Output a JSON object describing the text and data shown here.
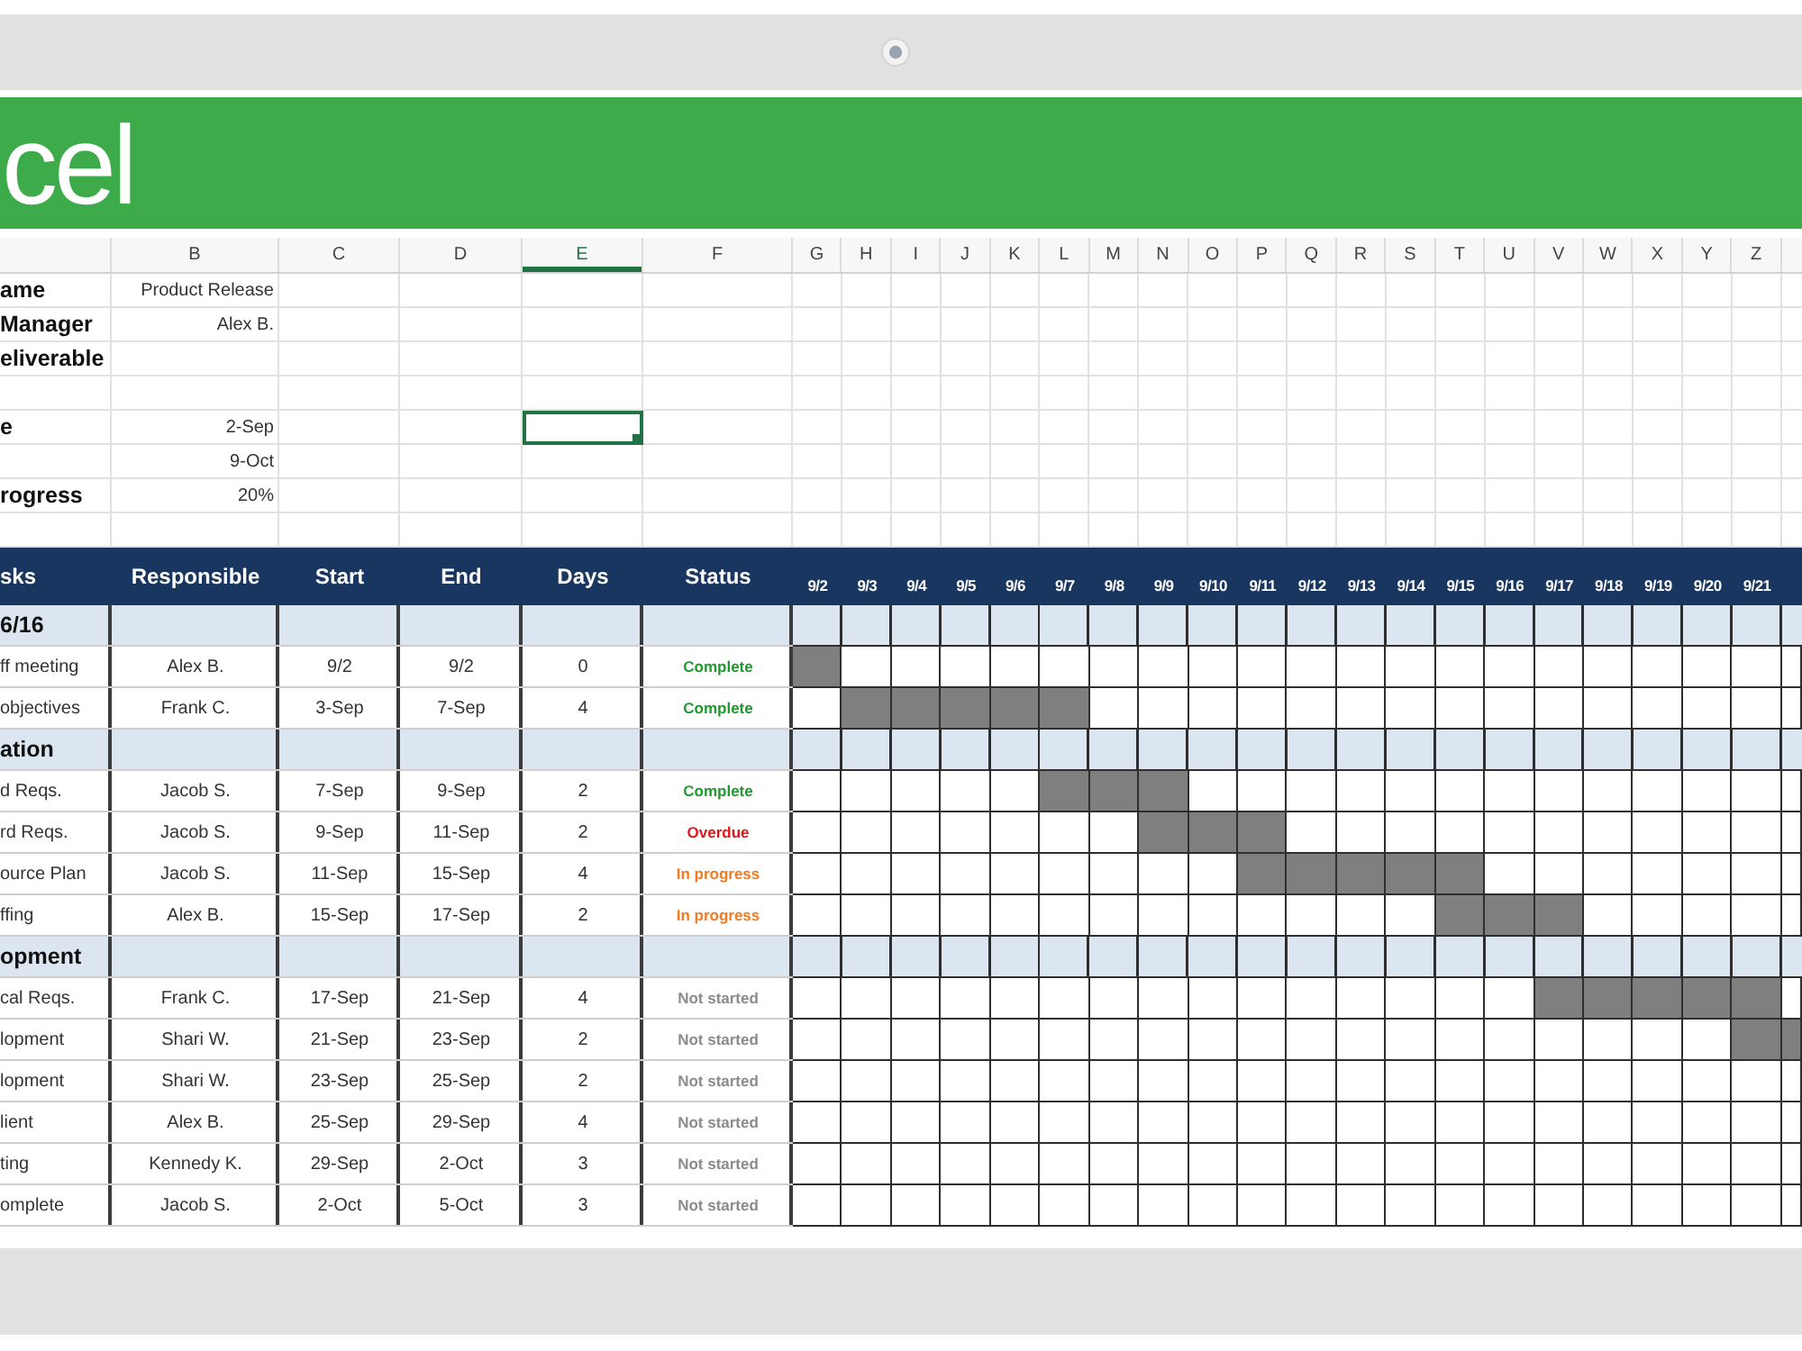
{
  "banner": {
    "title": "cel"
  },
  "sheet": {
    "column_headers": [
      {
        "label": "B",
        "selected": false
      },
      {
        "label": "C",
        "selected": false
      },
      {
        "label": "D",
        "selected": false
      },
      {
        "label": "E",
        "selected": true
      },
      {
        "label": "F",
        "selected": false
      },
      {
        "label": "G",
        "selected": false
      },
      {
        "label": "H",
        "selected": false
      },
      {
        "label": "I",
        "selected": false
      },
      {
        "label": "J",
        "selected": false
      },
      {
        "label": "K",
        "selected": false
      },
      {
        "label": "L",
        "selected": false
      },
      {
        "label": "M",
        "selected": false
      },
      {
        "label": "N",
        "selected": false
      },
      {
        "label": "O",
        "selected": false
      },
      {
        "label": "P",
        "selected": false
      },
      {
        "label": "Q",
        "selected": false
      },
      {
        "label": "R",
        "selected": false
      },
      {
        "label": "S",
        "selected": false
      },
      {
        "label": "T",
        "selected": false
      },
      {
        "label": "U",
        "selected": false
      },
      {
        "label": "V",
        "selected": false
      },
      {
        "label": "W",
        "selected": false
      },
      {
        "label": "X",
        "selected": false
      },
      {
        "label": "Y",
        "selected": false
      },
      {
        "label": "Z",
        "selected": false
      }
    ],
    "info_rows": [
      {
        "label": "ame",
        "value": "Product Release",
        "selected": false
      },
      {
        "label": "Manager",
        "value": "Alex B.",
        "selected": false
      },
      {
        "label": "eliverable",
        "selected": false
      },
      {
        "selected": false
      },
      {
        "label": "e",
        "value": "2-Sep",
        "selected": true
      },
      {
        "value": "9-Oct",
        "selected": false
      },
      {
        "label": "rogress",
        "value": "20%",
        "selected": false
      },
      {
        "selected": false
      }
    ]
  },
  "task_table": {
    "columns": [
      "sks",
      "Responsible",
      "Start",
      "End",
      "Days",
      "Status"
    ],
    "timeline_dates": [
      "9/2",
      "9/3",
      "9/4",
      "9/5",
      "9/6",
      "9/7",
      "9/8",
      "9/9",
      "9/10",
      "9/11",
      "9/12",
      "9/13",
      "9/14",
      "9/15",
      "9/16",
      "9/17",
      "9/18",
      "9/19",
      "9/20",
      "9/21"
    ],
    "sections": [
      {
        "title": "6/16",
        "tasks": [
          {
            "name": "ff meeting",
            "responsible": "Alex B.",
            "start": "9/2",
            "end": "9/2",
            "days": "0",
            "status": "Complete",
            "color": "#1e9b2d",
            "timeline": [
              true,
              false,
              false,
              false,
              false,
              false,
              false,
              false,
              false,
              false,
              false,
              false,
              false,
              false,
              false,
              false,
              false,
              false,
              false,
              false,
              false
            ]
          },
          {
            "name": "objectives",
            "responsible": "Frank C.",
            "start": "3-Sep",
            "end": "7-Sep",
            "days": "4",
            "status": "Complete",
            "color": "#1e9b2d",
            "timeline": [
              false,
              true,
              true,
              true,
              true,
              true,
              false,
              false,
              false,
              false,
              false,
              false,
              false,
              false,
              false,
              false,
              false,
              false,
              false,
              false,
              false
            ]
          }
        ]
      },
      {
        "title": "ation",
        "tasks": [
          {
            "name": "d Reqs.",
            "responsible": "Jacob S.",
            "start": "7-Sep",
            "end": "9-Sep",
            "days": "2",
            "status": "Complete",
            "color": "#1e9b2d",
            "timeline": [
              false,
              false,
              false,
              false,
              false,
              true,
              true,
              true,
              false,
              false,
              false,
              false,
              false,
              false,
              false,
              false,
              false,
              false,
              false,
              false,
              false
            ]
          },
          {
            "name": "rd Reqs.",
            "responsible": "Jacob S.",
            "start": "9-Sep",
            "end": "11-Sep",
            "days": "2",
            "status": "Overdue",
            "color": "#e3161b",
            "timeline": [
              false,
              false,
              false,
              false,
              false,
              false,
              false,
              true,
              true,
              true,
              false,
              false,
              false,
              false,
              false,
              false,
              false,
              false,
              false,
              false,
              false
            ]
          },
          {
            "name": "ource Plan",
            "responsible": "Jacob S.",
            "start": "11-Sep",
            "end": "15-Sep",
            "days": "4",
            "status": "In progress",
            "color": "#f47b20",
            "timeline": [
              false,
              false,
              false,
              false,
              false,
              false,
              false,
              false,
              false,
              true,
              true,
              true,
              true,
              true,
              false,
              false,
              false,
              false,
              false,
              false,
              false
            ]
          },
          {
            "name": "ffing",
            "responsible": "Alex B.",
            "start": "15-Sep",
            "end": "17-Sep",
            "days": "2",
            "status": "In progress",
            "color": "#f47b20",
            "timeline": [
              false,
              false,
              false,
              false,
              false,
              false,
              false,
              false,
              false,
              false,
              false,
              false,
              false,
              true,
              true,
              true,
              false,
              false,
              false,
              false,
              false
            ]
          }
        ]
      },
      {
        "title": "opment",
        "tasks": [
          {
            "name": "cal Reqs.",
            "responsible": "Frank C.",
            "start": "17-Sep",
            "end": "21-Sep",
            "days": "4",
            "status": "Not started",
            "color": "#8c8c8c",
            "timeline": [
              false,
              false,
              false,
              false,
              false,
              false,
              false,
              false,
              false,
              false,
              false,
              false,
              false,
              false,
              false,
              true,
              true,
              true,
              true,
              true,
              false
            ]
          },
          {
            "name": "lopment",
            "responsible": "Shari W.",
            "start": "21-Sep",
            "end": "23-Sep",
            "days": "2",
            "status": "Not started",
            "color": "#8c8c8c",
            "timeline": [
              false,
              false,
              false,
              false,
              false,
              false,
              false,
              false,
              false,
              false,
              false,
              false,
              false,
              false,
              false,
              false,
              false,
              false,
              false,
              true,
              true
            ]
          },
          {
            "name": "lopment",
            "responsible": "Shari W.",
            "start": "23-Sep",
            "end": "25-Sep",
            "days": "2",
            "status": "Not started",
            "color": "#8c8c8c",
            "timeline": [
              false,
              false,
              false,
              false,
              false,
              false,
              false,
              false,
              false,
              false,
              false,
              false,
              false,
              false,
              false,
              false,
              false,
              false,
              false,
              false,
              false
            ]
          },
          {
            "name": "lient",
            "responsible": "Alex B.",
            "start": "25-Sep",
            "end": "29-Sep",
            "days": "4",
            "status": "Not started",
            "color": "#8c8c8c",
            "timeline": [
              false,
              false,
              false,
              false,
              false,
              false,
              false,
              false,
              false,
              false,
              false,
              false,
              false,
              false,
              false,
              false,
              false,
              false,
              false,
              false,
              false
            ]
          },
          {
            "name": "ting",
            "responsible": "Kennedy K.",
            "start": "29-Sep",
            "end": "2-Oct",
            "days": "3",
            "status": "Not started",
            "color": "#8c8c8c",
            "timeline": [
              false,
              false,
              false,
              false,
              false,
              false,
              false,
              false,
              false,
              false,
              false,
              false,
              false,
              false,
              false,
              false,
              false,
              false,
              false,
              false,
              false
            ]
          },
          {
            "name": "omplete",
            "responsible": "Jacob S.",
            "start": "2-Oct",
            "end": "5-Oct",
            "days": "3",
            "status": "Not started",
            "color": "#8c8c8c",
            "timeline": [
              false,
              false,
              false,
              false,
              false,
              false,
              false,
              false,
              false,
              false,
              false,
              false,
              false,
              false,
              false,
              false,
              false,
              false,
              false,
              false,
              false
            ]
          }
        ]
      }
    ]
  }
}
